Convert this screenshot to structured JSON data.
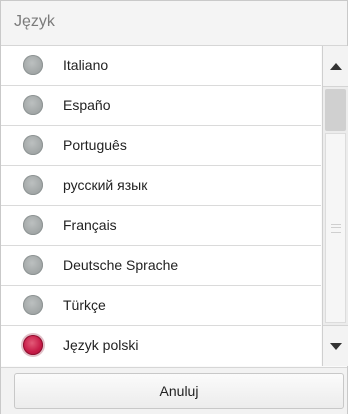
{
  "dialog": {
    "title": "Język",
    "options": [
      {
        "label": "Italiano",
        "selected": false
      },
      {
        "label": "Españo",
        "selected": false
      },
      {
        "label": "Português",
        "selected": false
      },
      {
        "label": "русский язык",
        "selected": false
      },
      {
        "label": "Français",
        "selected": false
      },
      {
        "label": "Deutsche Sprache",
        "selected": false
      },
      {
        "label": "Türkçe",
        "selected": false
      },
      {
        "label": "Język polski",
        "selected": true
      }
    ],
    "cancel_label": "Anuluj"
  },
  "icons": {
    "scroll_up": "triangle-up-icon",
    "scroll_down": "triangle-down-icon",
    "grip": "grip-lines-icon"
  },
  "colors": {
    "radio_selected": "#c71b47",
    "radio_unselected": "#a3a8a8"
  }
}
